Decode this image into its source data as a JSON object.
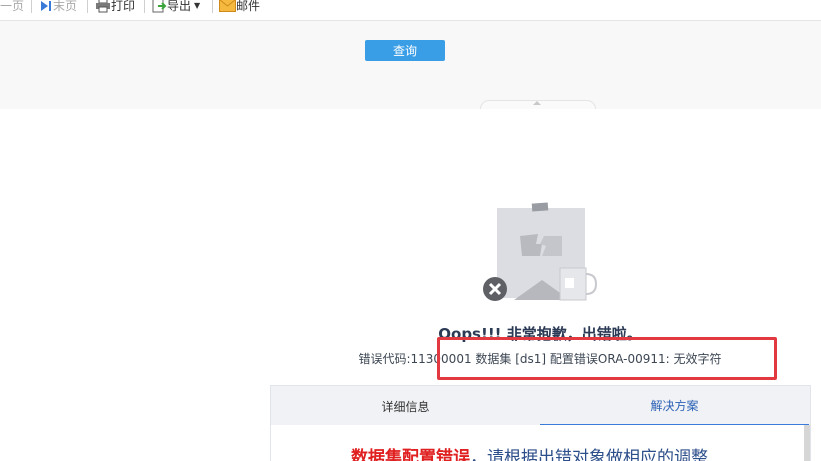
{
  "toolbar": {
    "prev_page": "一页",
    "last_page": "末页",
    "print": "打印",
    "export": "导出",
    "mail": "邮件"
  },
  "params": {
    "query_button": "查询"
  },
  "error": {
    "title": "Oops!!! 非常抱歉，出错啦。",
    "message": "错误代码:11300001 数据集 [ds1] 配置错误ORA-00911: 无效字符"
  },
  "tabs": [
    {
      "label": "详细信息",
      "active": false
    },
    {
      "label": "解决方案",
      "active": true
    }
  ],
  "solution": {
    "highlight": "数据集配置错误",
    "text": "，请根据出错对象做相应的调整"
  },
  "colors": {
    "accent": "#3a9ee6",
    "highlight_border": "#e2383f",
    "active_tab": "#2c62b6",
    "error_red": "#e02020"
  }
}
